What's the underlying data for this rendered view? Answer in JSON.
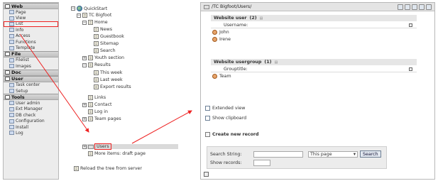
{
  "menu": {
    "groups": [
      {
        "title": "Web",
        "items": [
          "Page",
          "View",
          "List",
          "Info",
          "Access",
          "Functions",
          "Template"
        ]
      },
      {
        "title": "File",
        "items": [
          "Filelist",
          "Images"
        ]
      },
      {
        "title": "Doc",
        "items": []
      },
      {
        "title": "User",
        "items": [
          "Task center",
          "Setup"
        ]
      },
      {
        "title": "Tools",
        "items": [
          "User admin",
          "Ext Manager",
          "DB check",
          "Configuration",
          "Install",
          "Log"
        ]
      }
    ],
    "highlighted_item": "List"
  },
  "tree": {
    "nodes": [
      {
        "label": "QuickStart",
        "level": 0,
        "icon": "globe-icon",
        "toggle": "−"
      },
      {
        "label": "TC Bigfoot",
        "level": 1,
        "icon": "page-icon",
        "toggle": "−"
      },
      {
        "label": "Home",
        "level": 2,
        "icon": "page-icon",
        "toggle": "−"
      },
      {
        "label": "News",
        "level": 3,
        "icon": "page-icon",
        "toggle": ""
      },
      {
        "label": "Guestbook",
        "level": 3,
        "icon": "page-icon",
        "toggle": ""
      },
      {
        "label": "Sitemap",
        "level": 3,
        "icon": "page-icon",
        "toggle": ""
      },
      {
        "label": "Search",
        "level": 3,
        "icon": "page-icon",
        "toggle": ""
      },
      {
        "label": "Youth section",
        "level": 2,
        "icon": "page-icon",
        "toggle": "+"
      },
      {
        "label": "Results",
        "level": 2,
        "icon": "page-icon",
        "toggle": "−"
      },
      {
        "label": "This week",
        "level": 3,
        "icon": "page-icon",
        "toggle": ""
      },
      {
        "label": "Last week",
        "level": 3,
        "icon": "page-icon",
        "toggle": ""
      },
      {
        "label": "Export results",
        "level": 3,
        "icon": "page-icon",
        "toggle": ""
      },
      {
        "label": "Links",
        "level": 2,
        "icon": "page-icon",
        "toggle": ""
      },
      {
        "label": "Contact",
        "level": 2,
        "icon": "page-icon",
        "toggle": "+"
      },
      {
        "label": "Log in",
        "level": 2,
        "icon": "page-icon",
        "toggle": ""
      },
      {
        "label": "Team pages",
        "level": 2,
        "icon": "page-icon",
        "toggle": "+"
      },
      {
        "label": "Users",
        "level": 2,
        "icon": "sysfolder-icon",
        "toggle": "+",
        "selected": true
      },
      {
        "label": "More items: draft page",
        "level": 2,
        "icon": "page-icon",
        "toggle": ""
      }
    ],
    "reload_label": "Reload the tree from server"
  },
  "content": {
    "path": "/TC Bigfoot/Users/",
    "table_website_user": {
      "title": "Website user",
      "count": "(2)",
      "column": "Username:",
      "rows": [
        "John",
        "Irene"
      ]
    },
    "table_website_usergroup": {
      "title": "Website usergroup",
      "count": "(1)",
      "column": "Grouptitle:",
      "rows": [
        "Team"
      ]
    },
    "extended_view_label": "Extended view",
    "show_clipboard_label": "Show clipboard",
    "create_new_record_label": "Create new record",
    "search": {
      "search_string_label": "Search String:",
      "search_string_value": "",
      "scope_value": "This page",
      "search_button": "Search",
      "show_records_label": "Show records:",
      "show_records_value": ""
    }
  },
  "colors": {
    "annotation": "#ee2222",
    "header_bg": "#e4e4e4",
    "menu_bg": "#ececec"
  }
}
